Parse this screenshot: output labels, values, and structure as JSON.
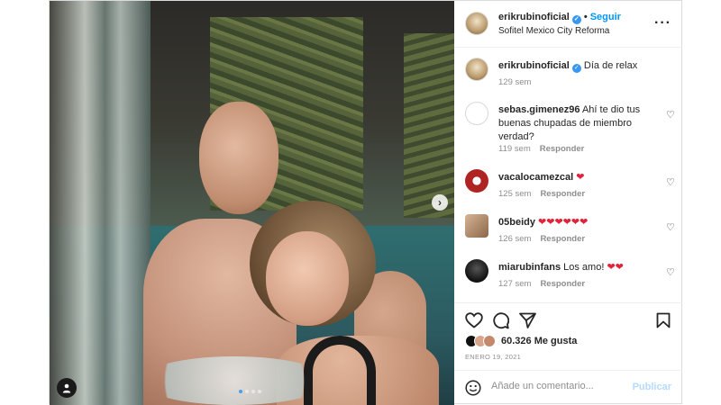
{
  "post": {
    "author": "erikrubinoficial",
    "follow_label": "Seguir",
    "location": "Sofitel Mexico City Reforma",
    "more_icon": "more-horizontal-icon",
    "next_icon": "chevron-right-icon",
    "tag_icon": "user-tag-icon",
    "carousel_count": 4
  },
  "caption": {
    "author": "erikrubinoficial",
    "text": "Día de relax",
    "time": "129 sem"
  },
  "comments": [
    {
      "user": "sebas.gimenez96",
      "text": "Ahí te dio tus buenas chupadas de miembro verdad?",
      "hearts": 0,
      "time": "119 sem",
      "reply": "Responder"
    },
    {
      "user": "vacalocamezcal",
      "text": "",
      "hearts": 1,
      "time": "125 sem",
      "reply": "Responder"
    },
    {
      "user": "05beidy",
      "text": "",
      "hearts": 6,
      "time": "126 sem",
      "reply": "Responder"
    },
    {
      "user": "miarubinfans",
      "text": "Los amo!",
      "hearts": 2,
      "time": "127 sem",
      "reply": "Responder"
    }
  ],
  "actions": {
    "likes": "60.326 Me gusta",
    "date": "ENERO 19, 2021"
  },
  "add_comment": {
    "placeholder": "Añade un comentario...",
    "publish": "Publicar",
    "emoji_icon": "emoji-smile-icon"
  },
  "colors": {
    "accent": "#0095f6",
    "heart": "#e0223a",
    "publish_disabled": "#b3dbff",
    "muted": "#8e8e8e"
  }
}
